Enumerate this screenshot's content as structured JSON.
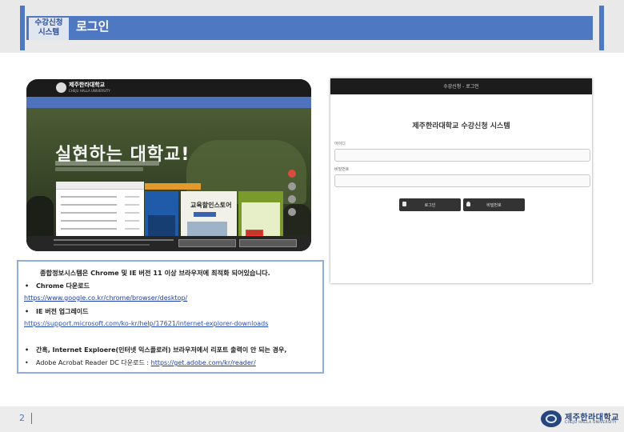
{
  "header": {
    "section_label_line1": "수강신청",
    "section_label_line2": "시스템",
    "title": "로그인"
  },
  "website": {
    "logo": "제주한라대학교",
    "logo_en": "CHEJU HALLA UNIVERSITY",
    "hero_text": "실현하는 대학교!",
    "card_title": "교육할인스토어"
  },
  "info": {
    "heading": "종합정보시스템은 Chrome 및 IE 버전 11 이상 브라우저에 최적화 되어있습니다.",
    "chrome_label": "Chrome 다운로드",
    "chrome_url": "https://www.google.co.kr/chrome/browser/desktop/",
    "ie_label": "IE 버전 업그레이드",
    "ie_url": "https://support.microsoft.com/ko-kr/help/17621/internet-explorer-downloads",
    "note": "간혹, Internet Exploere(인터넷 익스플로러) 브라우저에서 리포트 출력이 안 되는 경우,",
    "adobe_prefix": "Adobe Acrobat Reader DC 다운로드 : ",
    "adobe_url": "https://get.adobe.com/kr/reader/"
  },
  "login": {
    "window_title": "수강신청 - 로그인",
    "system_title": "제주한라대학교 수강신청 시스템",
    "id_label": "아이디",
    "pw_label": "비밀번호",
    "login_button": "로그인",
    "pw_change_button": "비밀번호"
  },
  "footer": {
    "page_number": "2",
    "logo_ko": "제주한라대학교",
    "logo_en": "CHEJU HALLA UNIVERSITY"
  }
}
